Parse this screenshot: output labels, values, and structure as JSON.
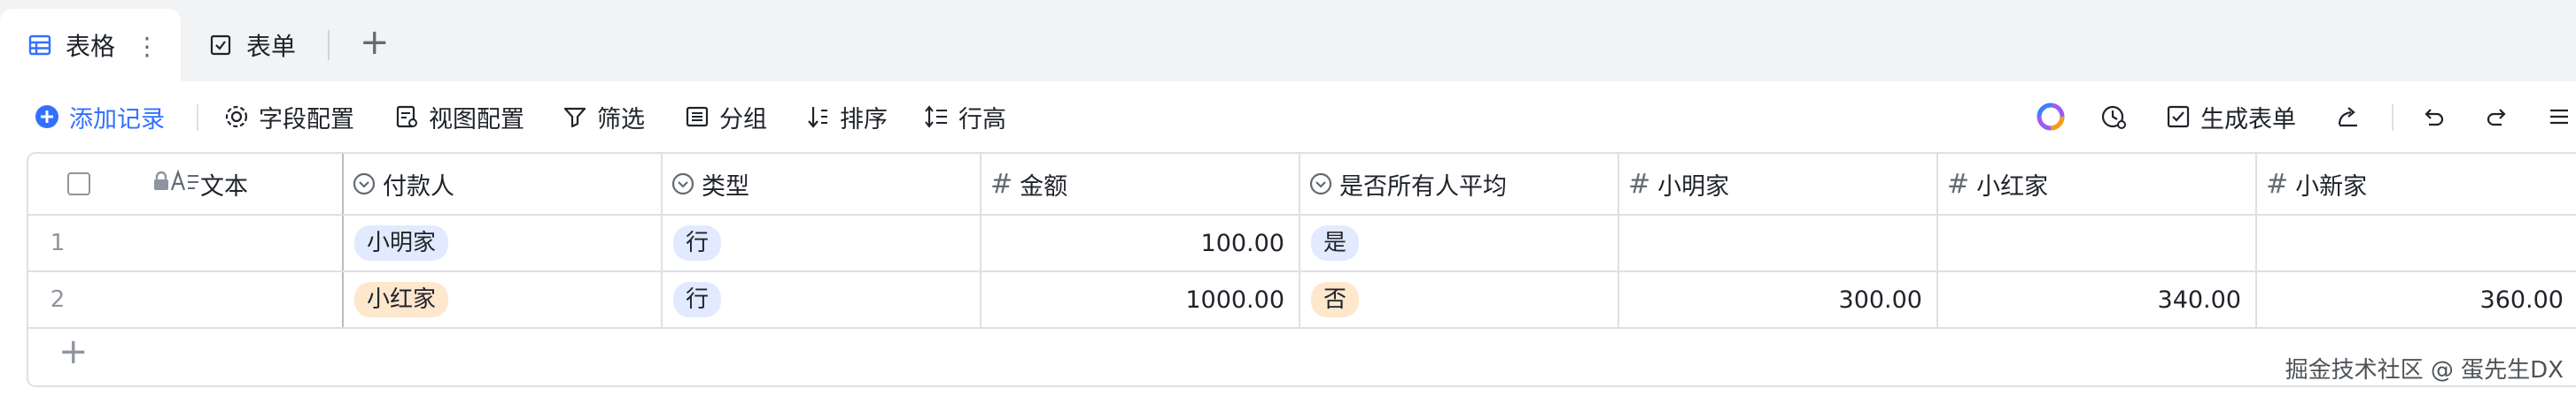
{
  "tabs": [
    {
      "label": "表格",
      "icon": "table-icon",
      "active": true
    },
    {
      "label": "表单",
      "icon": "form-icon",
      "active": false
    }
  ],
  "toolbar": {
    "add_record": "添加记录",
    "field_config": "字段配置",
    "view_config": "视图配置",
    "filter": "筛选",
    "group": "分组",
    "sort": "排序",
    "row_height": "行高",
    "generate_form": "生成表单"
  },
  "columns": [
    {
      "label": "文本",
      "icon": "text-field-icon",
      "locked": true
    },
    {
      "label": "付款人",
      "icon": "single-select-icon"
    },
    {
      "label": "类型",
      "icon": "single-select-icon"
    },
    {
      "label": "金额",
      "icon": "number-icon"
    },
    {
      "label": "是否所有人平均",
      "icon": "single-select-icon"
    },
    {
      "label": "小明家",
      "icon": "number-icon"
    },
    {
      "label": "小红家",
      "icon": "number-icon"
    },
    {
      "label": "小新家",
      "icon": "number-icon"
    }
  ],
  "rows": [
    {
      "index": "1",
      "text": "",
      "payer": "小明家",
      "type": "行",
      "amount": "100.00",
      "equal": "是",
      "xiaoming": "",
      "xiaohong": "",
      "xiaoxin": ""
    },
    {
      "index": "2",
      "text": "",
      "payer": "小红家",
      "type": "行",
      "amount": "1000.00",
      "equal": "否",
      "xiaoming": "300.00",
      "xiaohong": "340.00",
      "xiaoxin": "360.00"
    }
  ],
  "tag_colors": {
    "小明家": "#e1eaff",
    "小红家": "#fee7cd",
    "行": "#e1eaff",
    "是": "#e1eaff",
    "否": "#fee7cd"
  },
  "accent_color": "#3370ff",
  "watermark": "掘金技术社区 @ 蛋先生DX"
}
